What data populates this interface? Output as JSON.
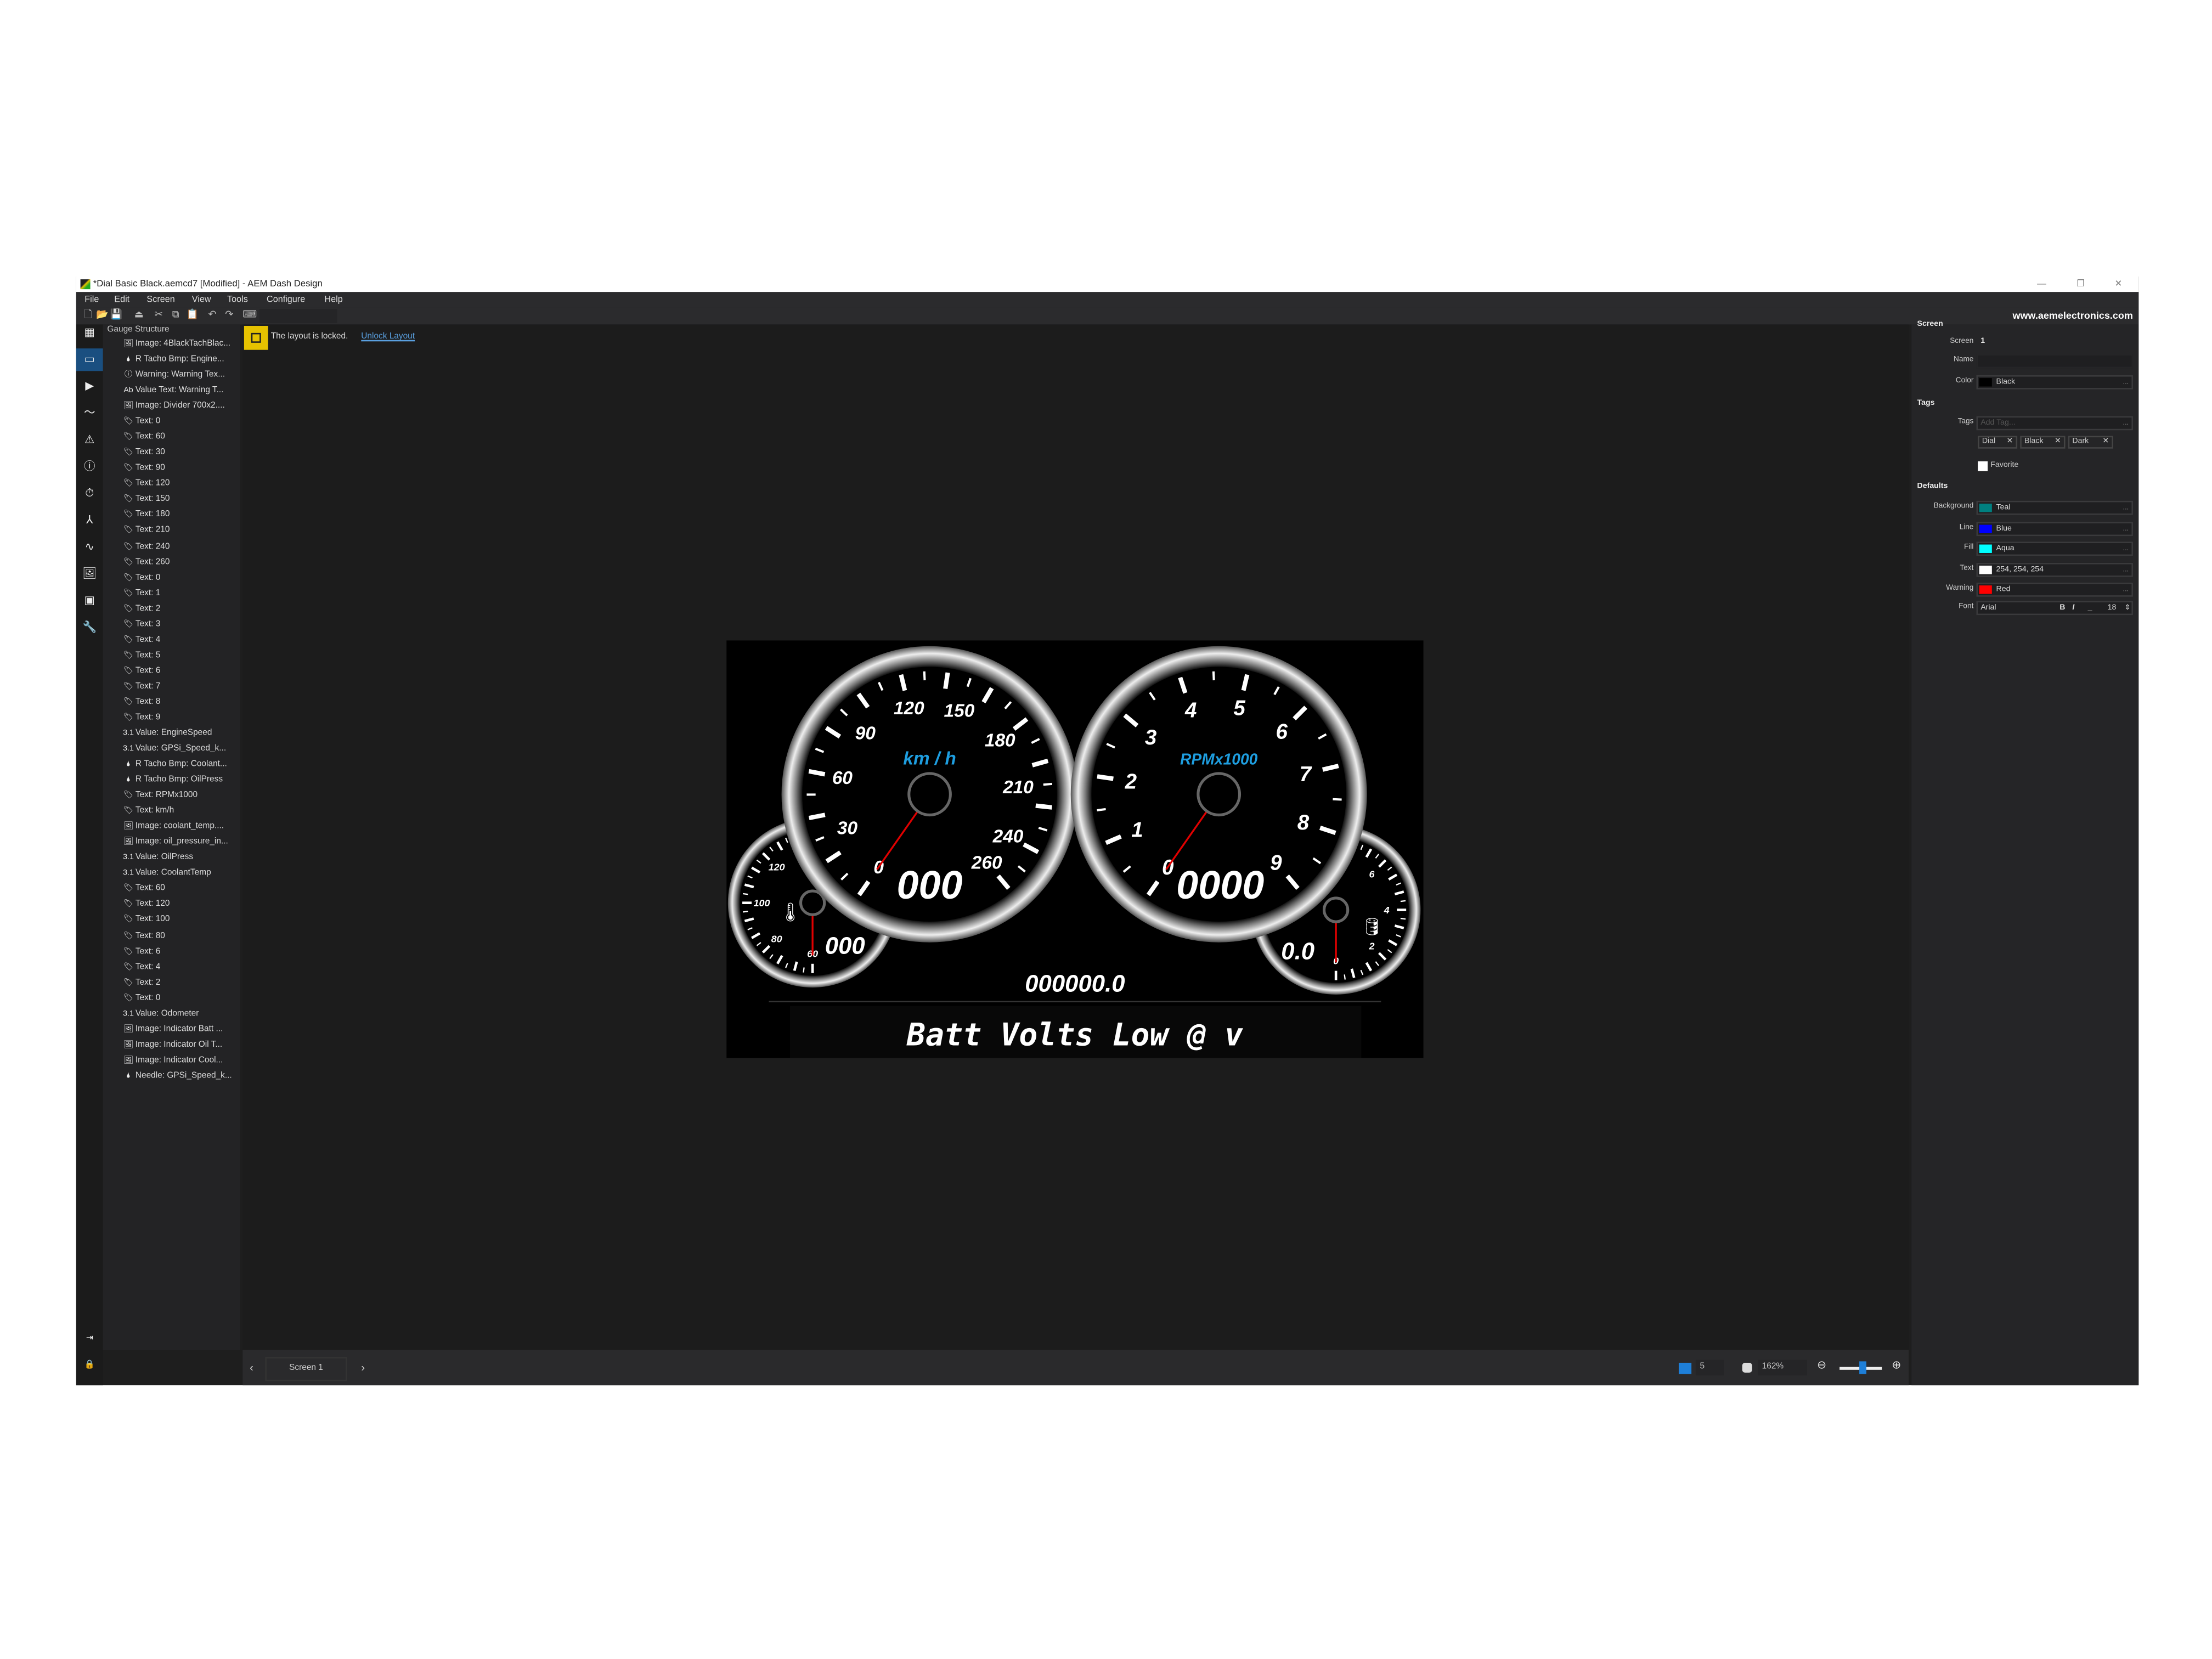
{
  "window": {
    "title": "*Dial Basic Black.aemcd7 [Modified] - AEM Dash Design",
    "controls": [
      "—",
      "❐",
      "✕"
    ]
  },
  "menu": [
    "File",
    "Edit",
    "Screen",
    "View",
    "Tools",
    "Configure",
    "Help"
  ],
  "toolbar": {
    "icons": [
      "new-file",
      "open-folder",
      "save",
      "upload",
      "cut",
      "copy",
      "paste",
      "undo",
      "redo",
      "keyboard"
    ],
    "glyphs": [
      "🗋",
      "📂",
      "💾",
      "⏏",
      "✂",
      "⧉",
      "📋",
      "↶",
      "↷",
      "⌨"
    ]
  },
  "sidebar_icons": [
    {
      "name": "grid-icon",
      "g": "▦"
    },
    {
      "name": "screen-icon",
      "g": "▭",
      "selected": true
    },
    {
      "name": "play-icon",
      "g": "▶"
    },
    {
      "name": "trend-icon",
      "g": "〜"
    },
    {
      "name": "warning-icon",
      "g": "⚠"
    },
    {
      "name": "alert-icon",
      "g": "ⓘ"
    },
    {
      "name": "stopwatch-icon",
      "g": "⏱"
    },
    {
      "name": "network-icon",
      "g": "⅄"
    },
    {
      "name": "chart-icon",
      "g": "∿"
    },
    {
      "name": "image-icon",
      "g": "🖼"
    },
    {
      "name": "images-icon",
      "g": "▣"
    },
    {
      "name": "wrench-icon",
      "g": "🔧"
    }
  ],
  "sidebar_bottom": [
    {
      "name": "expand-icon",
      "g": "⇥"
    },
    {
      "name": "lock-icon",
      "g": "🔒"
    }
  ],
  "tree": {
    "title": "Gauge Structure",
    "items": [
      {
        "t": "image",
        "label": "Image: 4BlackTachBlac..."
      },
      {
        "t": "needle",
        "label": "R Tacho Bmp: Engine..."
      },
      {
        "t": "warning",
        "label": "Warning: Warning Tex..."
      },
      {
        "t": "valuetext",
        "label": "Value Text: Warning T..."
      },
      {
        "t": "image",
        "label": "Image: Divider 700x2...."
      },
      {
        "t": "text",
        "label": "Text: 0"
      },
      {
        "t": "text",
        "label": "Text: 60"
      },
      {
        "t": "text",
        "label": "Text: 30"
      },
      {
        "t": "text",
        "label": "Text: 90"
      },
      {
        "t": "text",
        "label": "Text: 120"
      },
      {
        "t": "text",
        "label": "Text: 150"
      },
      {
        "t": "text",
        "label": "Text: 180"
      },
      {
        "t": "text",
        "label": "Text: 210"
      },
      {
        "t": "text",
        "label": "Text: 240"
      },
      {
        "t": "text",
        "label": "Text: 260"
      },
      {
        "t": "text",
        "label": "Text: 0"
      },
      {
        "t": "text",
        "label": "Text: 1"
      },
      {
        "t": "text",
        "label": "Text: 2"
      },
      {
        "t": "text",
        "label": "Text: 3"
      },
      {
        "t": "text",
        "label": "Text: 4"
      },
      {
        "t": "text",
        "label": "Text: 5"
      },
      {
        "t": "text",
        "label": "Text: 6"
      },
      {
        "t": "text",
        "label": "Text: 7"
      },
      {
        "t": "text",
        "label": "Text: 8"
      },
      {
        "t": "text",
        "label": "Text: 9"
      },
      {
        "t": "value",
        "label": "Value: EngineSpeed"
      },
      {
        "t": "value",
        "label": "Value: GPSi_Speed_k..."
      },
      {
        "t": "needle",
        "label": "R Tacho Bmp: Coolant..."
      },
      {
        "t": "needle",
        "label": "R Tacho Bmp: OilPress"
      },
      {
        "t": "text",
        "label": "Text: RPMx1000"
      },
      {
        "t": "text",
        "label": "Text: km/h"
      },
      {
        "t": "image",
        "label": "Image: coolant_temp...."
      },
      {
        "t": "image",
        "label": "Image: oil_pressure_in..."
      },
      {
        "t": "value",
        "label": "Value: OilPress"
      },
      {
        "t": "value",
        "label": "Value: CoolantTemp"
      },
      {
        "t": "text",
        "label": "Text: 60"
      },
      {
        "t": "text",
        "label": "Text: 120"
      },
      {
        "t": "text",
        "label": "Text: 100"
      },
      {
        "t": "text",
        "label": "Text: 80"
      },
      {
        "t": "text",
        "label": "Text: 6"
      },
      {
        "t": "text",
        "label": "Text: 4"
      },
      {
        "t": "text",
        "label": "Text: 2"
      },
      {
        "t": "text",
        "label": "Text: 0"
      },
      {
        "t": "value",
        "label": "Value: Odometer"
      },
      {
        "t": "image",
        "label": "Image: Indicator Batt ..."
      },
      {
        "t": "image",
        "label": "Image: Indicator Oil T..."
      },
      {
        "t": "image",
        "label": "Image: Indicator Cool..."
      },
      {
        "t": "needle",
        "label": "Needle: GPSi_Speed_k..."
      }
    ],
    "icon_glyphs": {
      "image": "🖼",
      "needle": "🌢",
      "warning": "ⓘ",
      "valuetext": "Ab",
      "text": "🏷",
      "value": "3.1"
    }
  },
  "lock": {
    "message": "The layout is locked.",
    "link": "Unlock Layout",
    "color": "#e6c200"
  },
  "status": {
    "screen_label": "Screen 1",
    "prev": "‹",
    "next": "›",
    "grid_value": "5",
    "zoom": "162%",
    "zoom_slider": 0.55
  },
  "panel": {
    "brand": "www.aemelectronics.com",
    "screen": {
      "header": "Screen",
      "screen_label": "Screen",
      "screen_value": "1",
      "name_label": "Name",
      "name_value": "",
      "color_label": "Color",
      "color_value": "Black",
      "color_hex": "#000000"
    },
    "tags": {
      "header": "Tags",
      "label": "Tags",
      "placeholder": "Add Tag...",
      "chips": [
        "Dial",
        "Black",
        "Dark"
      ],
      "favorite": "Favorite",
      "favorite_checked": false
    },
    "defaults": {
      "header": "Defaults",
      "rows": [
        {
          "label": "Background",
          "value": "Teal",
          "hex": "#008080"
        },
        {
          "label": "Line",
          "value": "Blue",
          "hex": "#0000ff"
        },
        {
          "label": "Fill",
          "value": "Aqua",
          "hex": "#00ffff"
        },
        {
          "label": "Text",
          "value": "254, 254, 254",
          "hex": "#fefefe"
        },
        {
          "label": "Warning",
          "value": "Red",
          "hex": "#ff0000"
        }
      ],
      "font_label": "Font",
      "font_value": "Arial",
      "bold": "B",
      "italic": "I",
      "underline": "_",
      "font_size": "18"
    }
  },
  "dash": {
    "speedo": {
      "labels": [
        "0",
        "30",
        "60",
        "90",
        "120",
        "150",
        "180",
        "210",
        "240",
        "260"
      ],
      "max": 260,
      "unit": "km / h",
      "value": "000"
    },
    "tacho": {
      "labels": [
        "0",
        "1",
        "2",
        "3",
        "4",
        "5",
        "6",
        "7",
        "8",
        "9"
      ],
      "max": 9,
      "unit": "RPMx1000",
      "value": "0000"
    },
    "coolant": {
      "labels": [
        "60",
        "80",
        "100",
        "120"
      ],
      "value": "000"
    },
    "oil": {
      "labels": [
        "0",
        "2",
        "4",
        "6"
      ],
      "value": "0.0"
    },
    "odometer": "000000.0",
    "warning": "Batt Volts Low @ v",
    "unit_color": "#1e9ee0",
    "needle_color": "#e00000"
  }
}
